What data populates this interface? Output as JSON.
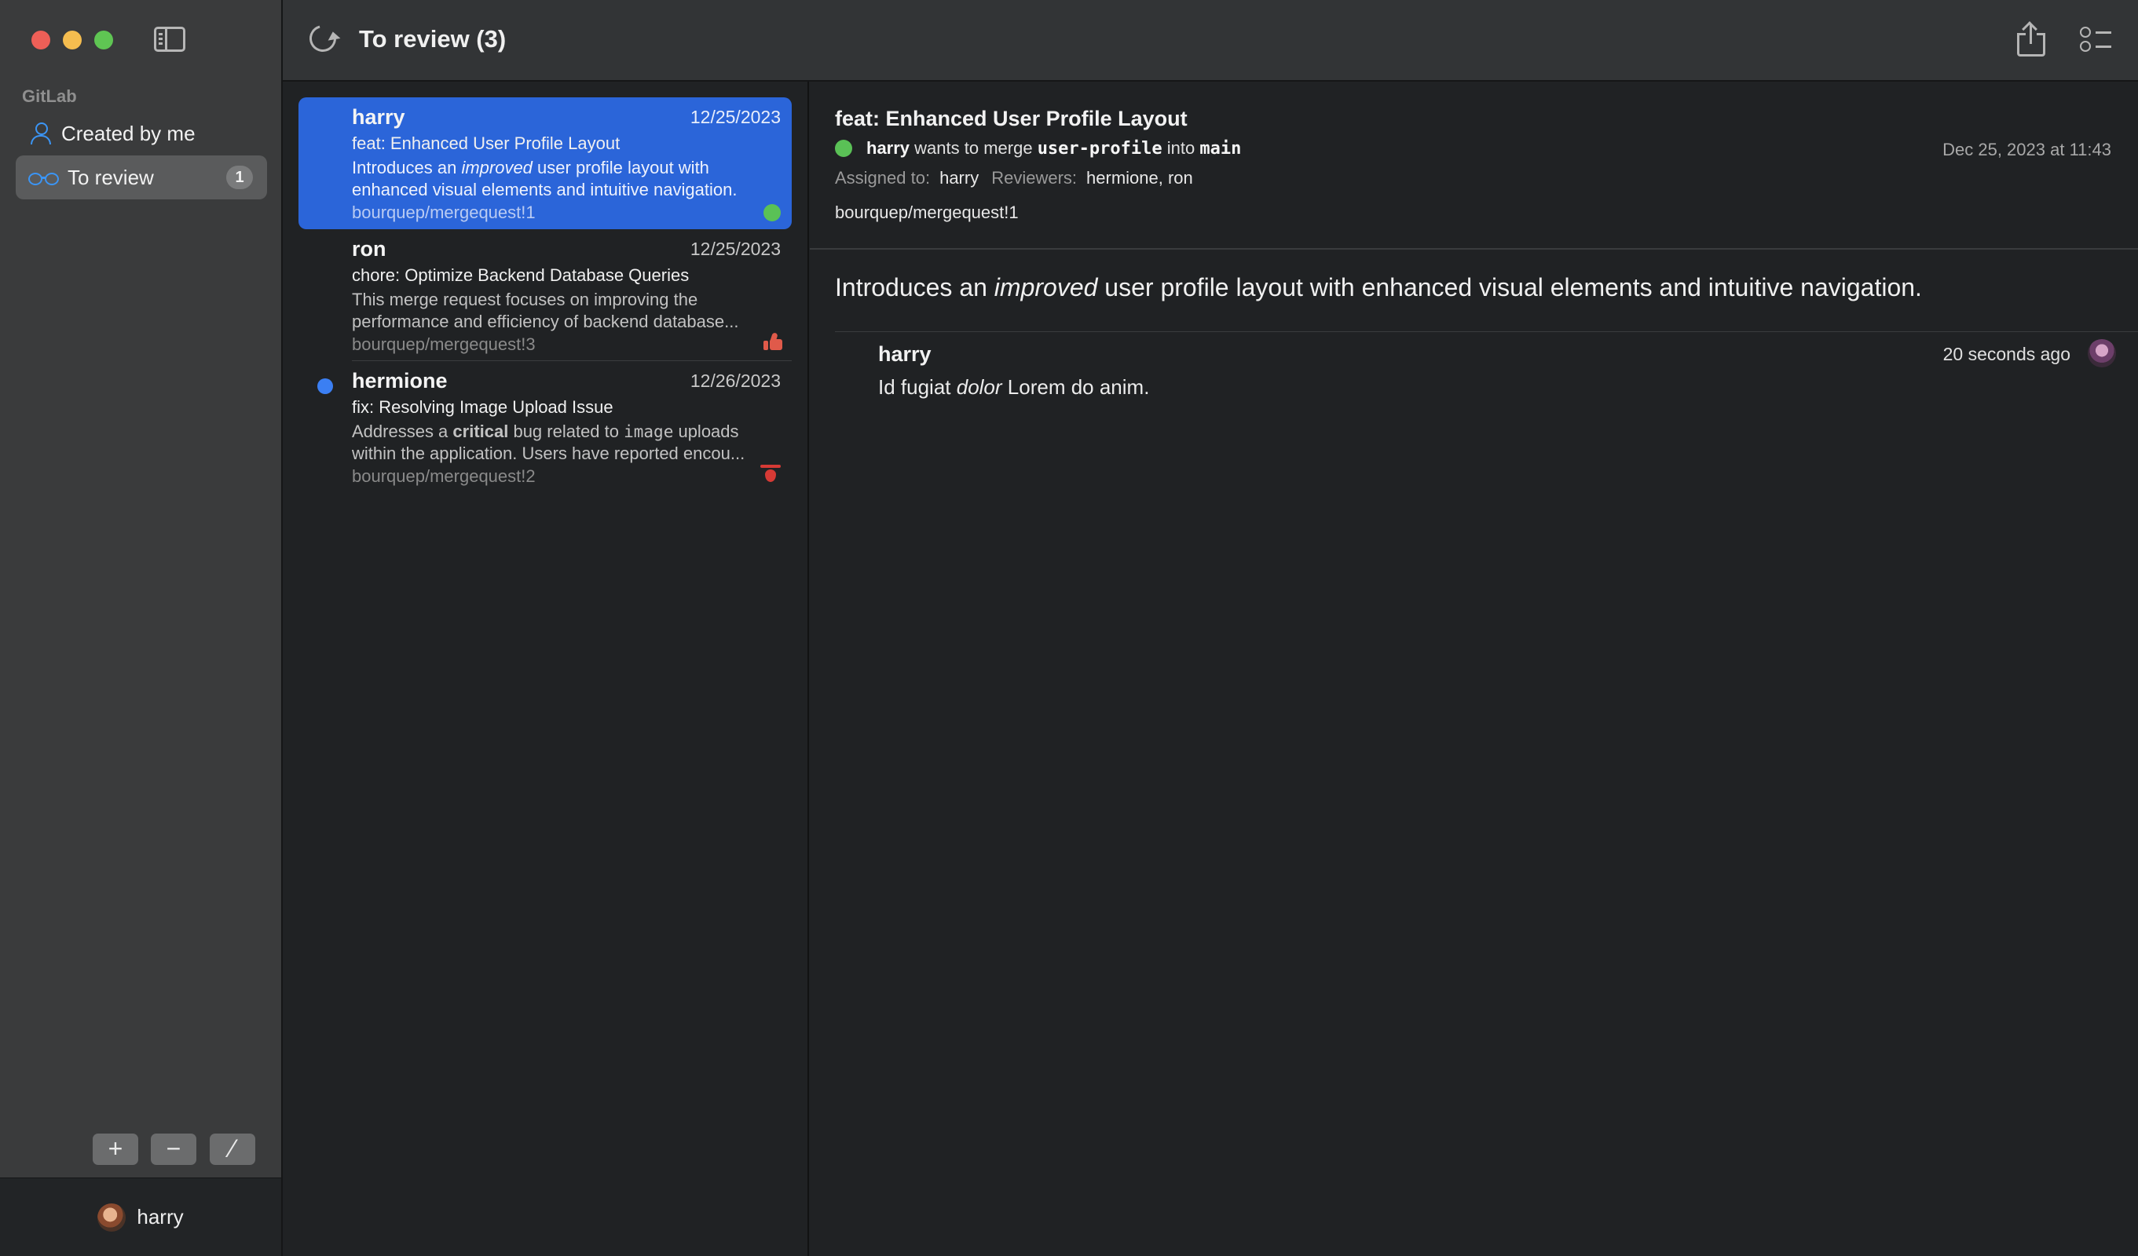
{
  "app": {
    "section_label": "GitLab"
  },
  "sidebar": {
    "items": [
      {
        "label": "Created by me",
        "icon": "person-icon"
      },
      {
        "label": "To review",
        "icon": "glasses-icon",
        "badge": "1"
      }
    ],
    "buttons": {
      "add": "+",
      "remove": "−",
      "edit": "⁄"
    },
    "user": "harry"
  },
  "toolbar": {
    "title": "To review (3)"
  },
  "merge_requests": [
    {
      "author": "harry",
      "date": "12/25/2023",
      "title": "feat: Enhanced User Profile Layout",
      "desc_pre": "Introduces an ",
      "desc_em": "improved",
      "desc_post": " user profile layout with enhanced visual elements and intuitive navigation.",
      "ref": "bourquep/mergequest!1",
      "status": "green-dot",
      "selected": true
    },
    {
      "author": "ron",
      "date": "12/25/2023",
      "title": "chore: Optimize Backend Database Queries",
      "desc": "This merge request focuses on improving the performance and efficiency of backend database...",
      "ref": "bourquep/mergequest!3",
      "status": "thumbs-up-icon"
    },
    {
      "author": "hermione",
      "date": "12/26/2023",
      "title": "fix: Resolving Image Upload Issue",
      "desc_pre": "Addresses a ",
      "desc_strong": "critical",
      "desc_mid": " bug related to ",
      "desc_code": "image",
      "desc_post": " uploads within the application. Users have reported encou...",
      "ref": "bourquep/mergequest!2",
      "status": "tada-icon",
      "unread": true
    }
  ],
  "detail": {
    "title": "feat: Enhanced User Profile Layout",
    "author": "harry",
    "merge_text_1": " wants to merge ",
    "source_branch": "user-profile",
    "merge_text_2": " into ",
    "target_branch": "main",
    "date": "Dec 25, 2023 at 11:43",
    "assigned_label": "Assigned to:",
    "assigned_value": "harry",
    "reviewers_label": "Reviewers:",
    "reviewers_value": "hermione, ron",
    "ref": "bourquep/mergequest!1",
    "desc_pre": "Introduces an ",
    "desc_em": "improved",
    "desc_post": " user profile layout with enhanced visual elements and intuitive navigation."
  },
  "comments": [
    {
      "author": "harry",
      "time": "20 seconds ago",
      "body_pre": "Id fugiat ",
      "body_em": "dolor",
      "body_post": " Lorem do anim."
    }
  ],
  "colors": {
    "accent": "#2b65d9",
    "success": "#5ac156",
    "unread": "#3b7ff3",
    "sidebar_icon": "#3b95f5"
  }
}
